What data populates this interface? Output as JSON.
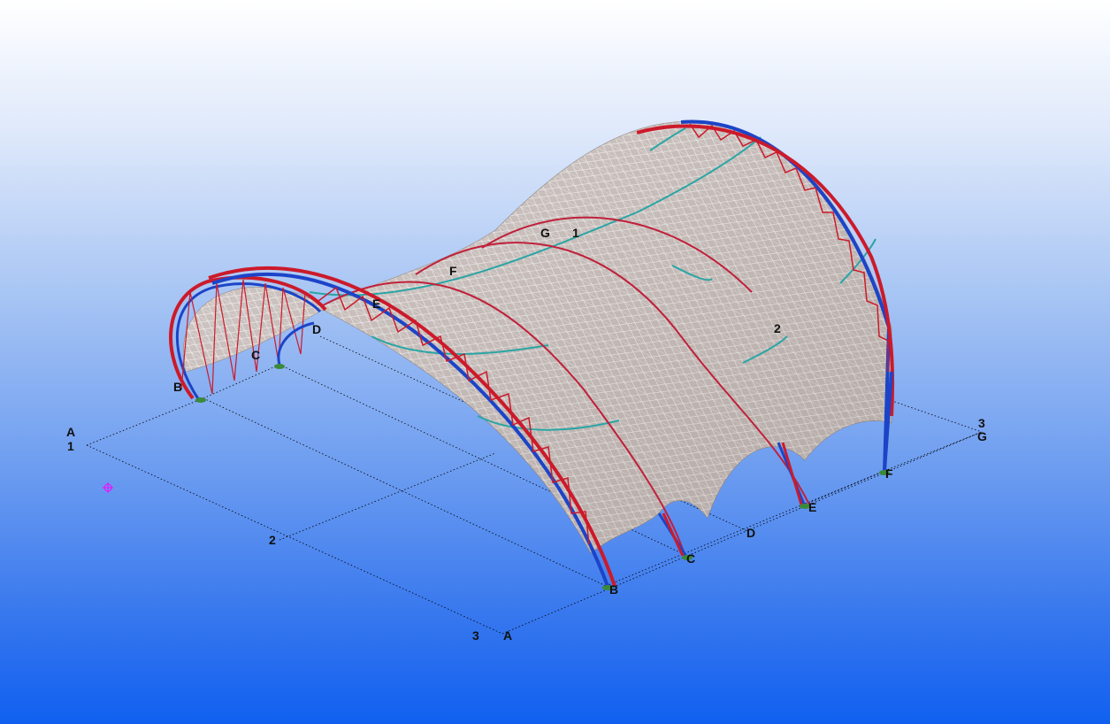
{
  "view": {
    "background_top": "#ffffff",
    "background_bottom": "#1060f0",
    "grid_color": "#000000",
    "membrane_color": "#c8bcb8",
    "membrane_mesh_color": "#ffffff",
    "arch_outer_color": "#cc1a2a",
    "arch_inner_color": "#1c44c8",
    "cable_color": "#2aa5a5",
    "support_color": "#3a8a3a",
    "marker_color": "#ff00ff",
    "marker_icon": "crosshair-icon"
  },
  "grid_labels": {
    "near_left": {
      "letter": "A",
      "number": "1"
    },
    "near_mid": {
      "number": "2"
    },
    "near_right": {
      "number": "3",
      "letter": "A"
    },
    "far_right": {
      "number": "3",
      "letter": "G"
    },
    "left_arch": {
      "B": "B",
      "C": "C",
      "D": "D"
    },
    "ridge": {
      "E": "E",
      "F": "F",
      "G": "G",
      "one": "1"
    },
    "right_mid": {
      "two": "2"
    },
    "front_supports": {
      "B": "B",
      "C": "C",
      "D": "D",
      "E": "E",
      "F": "F"
    }
  }
}
